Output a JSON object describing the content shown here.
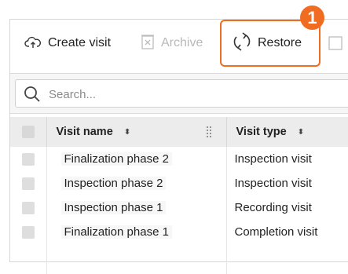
{
  "toolbar": {
    "create_label": "Create visit",
    "archive_label": "Archive",
    "restore_label": "Restore",
    "step_badge": "1"
  },
  "search": {
    "placeholder": "Search...",
    "value": ""
  },
  "table": {
    "headers": {
      "name": "Visit name",
      "type": "Visit type",
      "sort_indicator": "⬍"
    },
    "rows": [
      {
        "name": "Finalization phase 2",
        "type": "Inspection visit"
      },
      {
        "name": "Inspection phase 2",
        "type": "Inspection visit"
      },
      {
        "name": "Inspection phase 1",
        "type": "Recording visit"
      },
      {
        "name": "Finalization phase 1",
        "type": "Completion visit"
      }
    ]
  },
  "colors": {
    "accent": "#ef6c21",
    "disabled": "#b8b8b8",
    "header_bg": "#ececec"
  },
  "icons": [
    "cloud-upload-icon",
    "archive-box-icon",
    "restore-cycle-icon",
    "search-icon",
    "sort-icon",
    "column-grip-icon"
  ]
}
